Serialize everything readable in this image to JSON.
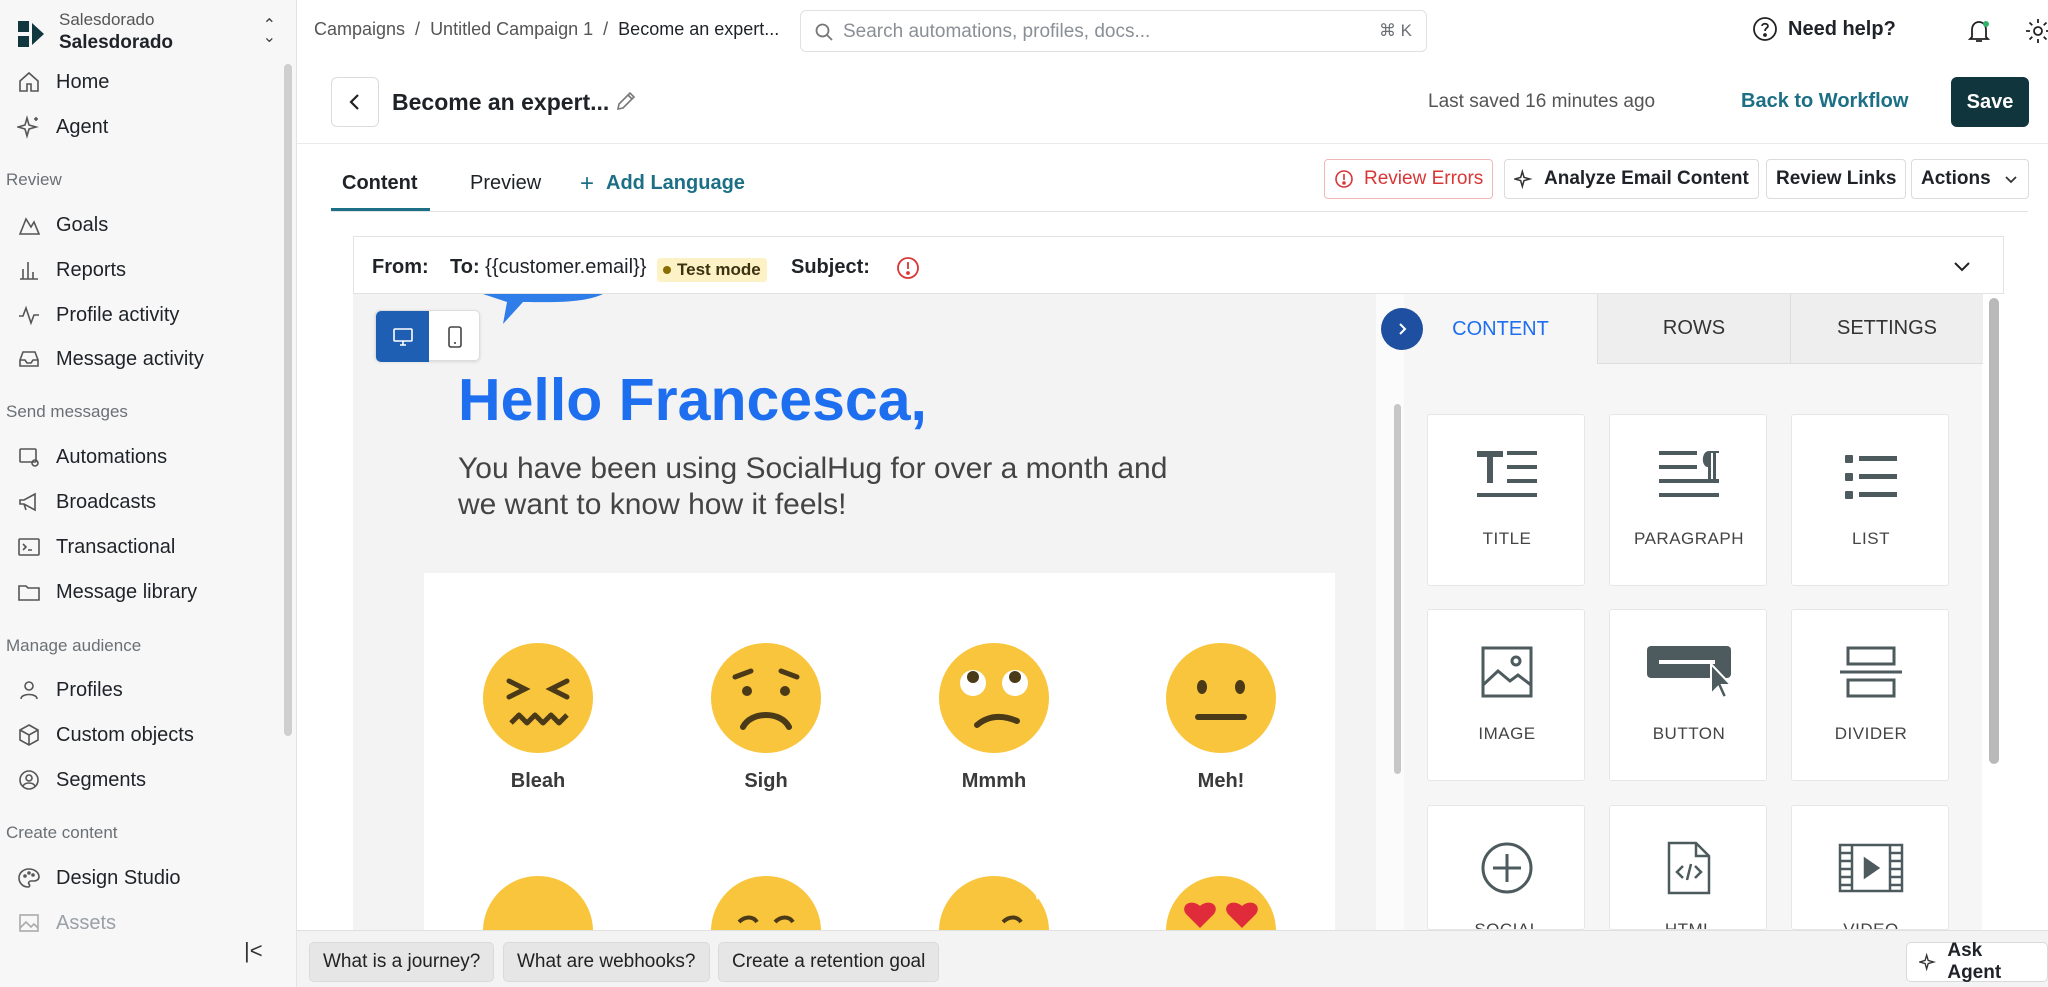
{
  "org": {
    "workspace_label": "Salesdorado",
    "workspace_name": "Salesdorado"
  },
  "sidebar": {
    "items_top": [
      {
        "label": "Home",
        "icon": "home-icon"
      },
      {
        "label": "Agent",
        "icon": "sparkle-icon"
      }
    ],
    "sections": [
      {
        "title": "Review",
        "items": [
          {
            "label": "Goals",
            "icon": "flask-icon"
          },
          {
            "label": "Reports",
            "icon": "bar-chart-icon"
          },
          {
            "label": "Profile activity",
            "icon": "activity-icon"
          },
          {
            "label": "Message activity",
            "icon": "inbox-icon"
          }
        ]
      },
      {
        "title": "Send messages",
        "items": [
          {
            "label": "Automations",
            "icon": "automation-icon"
          },
          {
            "label": "Broadcasts",
            "icon": "megaphone-icon"
          },
          {
            "label": "Transactional",
            "icon": "terminal-icon"
          },
          {
            "label": "Message library",
            "icon": "folder-icon"
          }
        ]
      },
      {
        "title": "Manage audience",
        "items": [
          {
            "label": "Profiles",
            "icon": "person-icon"
          },
          {
            "label": "Custom objects",
            "icon": "cube-icon"
          },
          {
            "label": "Segments",
            "icon": "segments-icon"
          }
        ]
      },
      {
        "title": "Create content",
        "items": [
          {
            "label": "Design Studio",
            "icon": "palette-icon"
          },
          {
            "label": "Assets",
            "icon": "image-icon"
          }
        ]
      }
    ]
  },
  "breadcrumb": [
    "Campaigns",
    "Untitled Campaign 1",
    "Become an expert..."
  ],
  "search": {
    "placeholder": "Search automations, profiles, docs...",
    "shortcut": "⌘ K"
  },
  "topbar": {
    "help_label": "Need help?"
  },
  "editor": {
    "title": "Become an expert...",
    "last_saved": "Last saved 16 minutes ago",
    "back_to_workflow": "Back to Workflow",
    "save": "Save",
    "tabs": {
      "content": "Content",
      "preview": "Preview",
      "add_language": "Add Language"
    },
    "toolbar": {
      "review_errors": "Review Errors",
      "analyze": "Analyze Email Content",
      "review_links": "Review Links",
      "actions": "Actions"
    }
  },
  "email_header": {
    "from_label": "From:",
    "to_label": "To:",
    "to_value": "{{customer.email}}",
    "test_mode": "Test mode",
    "subject_label": "Subject:"
  },
  "email_body": {
    "greeting": "Hello Francesca,",
    "subtitle": "You have been using SocialHug for over a month and we want to know how it feels!",
    "emojis": [
      {
        "label": "Bleah",
        "icon": "confounded-face-icon"
      },
      {
        "label": "Sigh",
        "icon": "worried-face-icon"
      },
      {
        "label": "Mmmh",
        "icon": "eye-roll-face-icon"
      },
      {
        "label": "Meh!",
        "icon": "neutral-face-icon"
      }
    ]
  },
  "right_panel": {
    "tabs": [
      "CONTENT",
      "ROWS",
      "SETTINGS"
    ],
    "blocks": [
      {
        "label": "TITLE",
        "icon": "title-block-icon"
      },
      {
        "label": "PARAGRAPH",
        "icon": "paragraph-block-icon"
      },
      {
        "label": "LIST",
        "icon": "list-block-icon"
      },
      {
        "label": "IMAGE",
        "icon": "image-block-icon"
      },
      {
        "label": "BUTTON",
        "icon": "button-block-icon"
      },
      {
        "label": "DIVIDER",
        "icon": "divider-block-icon"
      },
      {
        "label": "SOCIAL",
        "icon": "social-block-icon"
      },
      {
        "label": "HTML",
        "icon": "html-block-icon"
      },
      {
        "label": "VIDEO",
        "icon": "video-block-icon"
      }
    ]
  },
  "bottom_bar": {
    "suggestions": [
      "What is a journey?",
      "What are webhooks?",
      "Create a retention goal"
    ],
    "ask_agent": "Ask Agent"
  },
  "colors": {
    "accent": "#1d6f86",
    "save_bg": "#11353d",
    "greeting": "#1e6ff0",
    "error": "#d93636",
    "emoji": "#f9c53d"
  }
}
